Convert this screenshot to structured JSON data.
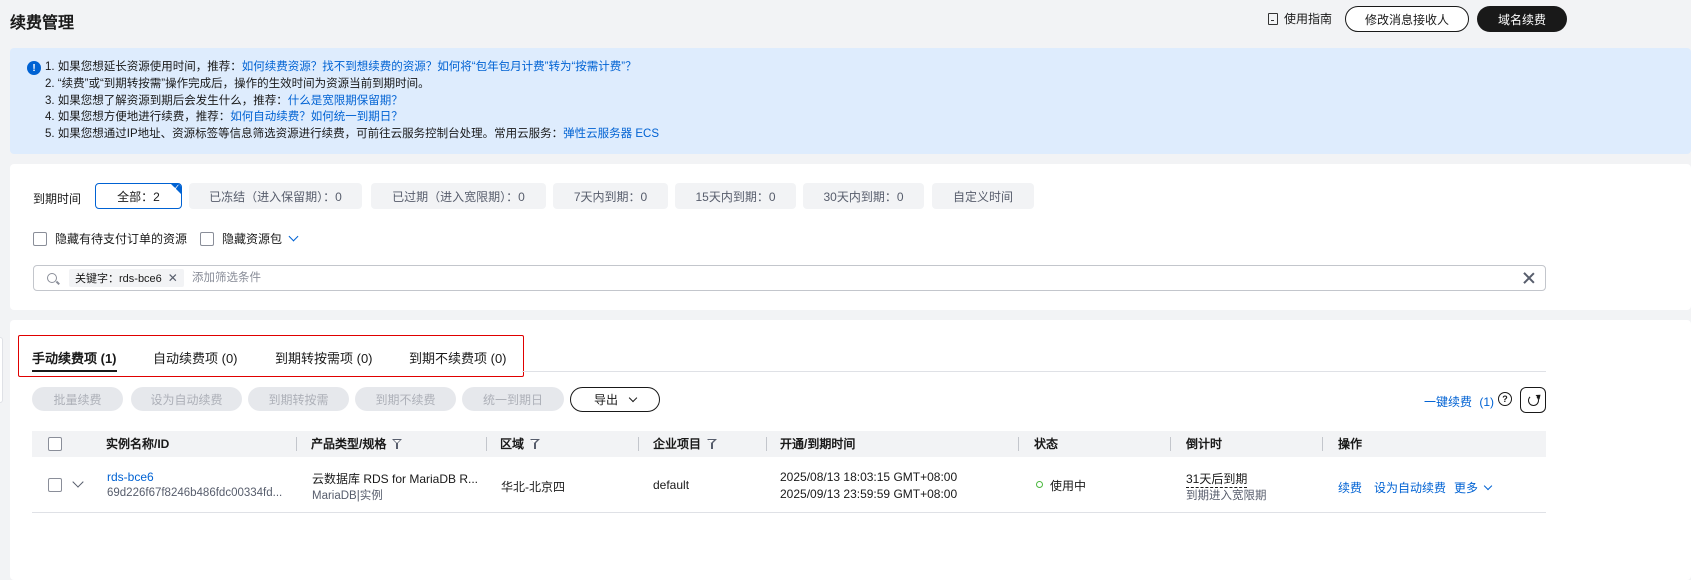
{
  "header": {
    "title": "续费管理",
    "guide_label": "使用指南",
    "edit_receiver_label": "修改消息接收人",
    "domain_renew_label": "域名续费"
  },
  "notice": {
    "lines": [
      {
        "text": "1. 如果您想延长资源使用时间，推荐：",
        "link": "如何续费资源？找不到想续费的资源？如何将“包年包月计费”转为“按需计费”？"
      },
      {
        "text": "2. “续费”或“到期转按需”操作完成后，操作的生效时间为资源当前到期时间。",
        "link": ""
      },
      {
        "text": "3. 如果您想了解资源到期后会发生什么，推荐：",
        "link": "什么是宽限期保留期？"
      },
      {
        "text": "4. 如果您想方便地进行续费，推荐：",
        "link": "如何自动续费？如何统一到期日？"
      },
      {
        "text": "5. 如果您想通过IP地址、资源标签等信息筛选资源进行续费，可前往云服务控制台处理。常用云服务：",
        "link": "弹性云服务器 ECS"
      }
    ]
  },
  "filter": {
    "label": "到期时间",
    "chips": [
      {
        "label": "全部：2",
        "active": true
      },
      {
        "label": "已冻结（进入保留期）：0",
        "active": false
      },
      {
        "label": "已过期（进入宽限期）：0",
        "active": false
      },
      {
        "label": "7天内到期：0",
        "active": false
      },
      {
        "label": "15天内到期：0",
        "active": false
      },
      {
        "label": "30天内到期：0",
        "active": false
      },
      {
        "label": "自定义时间",
        "active": false
      }
    ],
    "hide_pending_label": "隐藏有待支付订单的资源",
    "hide_package_label": "隐藏资源包",
    "keyword_tag": "关键字：rds-bce6",
    "search_placeholder": "添加筛选条件"
  },
  "tabs": [
    {
      "label": "手动续费项 (1)",
      "active": true
    },
    {
      "label": "自动续费项 (0)",
      "active": false
    },
    {
      "label": "到期转按需项 (0)",
      "active": false
    },
    {
      "label": "到期不续费项 (0)",
      "active": false
    }
  ],
  "toolbar": {
    "batch_renew": "批量续费",
    "set_auto": "设为自动续费",
    "to_ondemand": "到期转按需",
    "no_renew": "到期不续费",
    "unify_date": "统一到期日",
    "export": "导出",
    "one_click": "一键续费",
    "one_click_count": "(1)",
    "help": "?"
  },
  "table": {
    "headers": {
      "instance": "实例名称/ID",
      "product": "产品类型/规格",
      "region": "区域",
      "enterprise": "企业项目",
      "time": "开通/到期时间",
      "status": "状态",
      "countdown": "倒计时",
      "ops": "操作"
    },
    "rows": [
      {
        "name": "rds-bce6",
        "id": "69d226f67f8246b486fdc00334fd...",
        "product": "云数据库 RDS for MariaDB R...",
        "spec": "MariaDB|实例",
        "region": "华北-北京四",
        "enterprise": "default",
        "open_time": "2025/08/13 18:03:15 GMT+08:00",
        "expire_time": "2025/09/13 23:59:59 GMT+08:00",
        "status": "使用中",
        "countdown": "31天后到期",
        "countdown_sub": "到期进入宽限期",
        "op_renew": "续费",
        "op_auto": "设为自动续费",
        "op_more": "更多"
      }
    ]
  },
  "colors": {
    "accent": "#0062d3",
    "notice_bg": "#deecfd",
    "status_green": "#4ab83e",
    "highlight_red": "#e00000"
  }
}
